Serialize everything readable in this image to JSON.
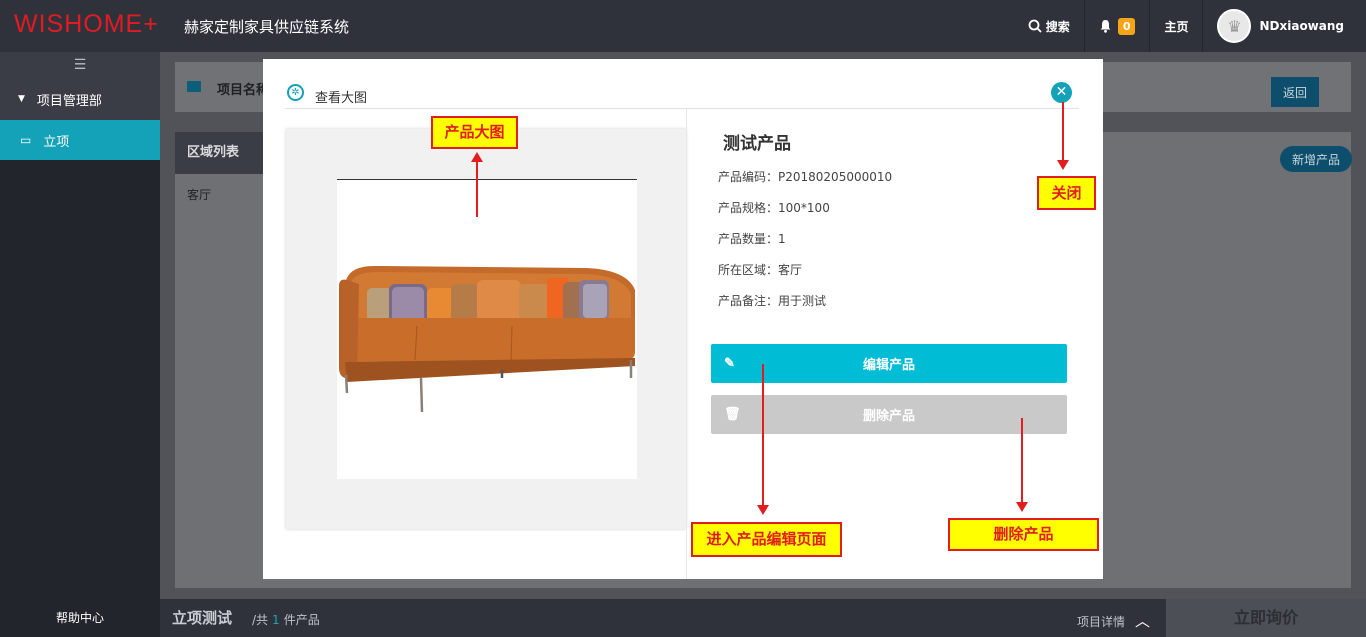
{
  "header": {
    "logo": "WISHOME+",
    "system_title": "赫家定制家具供应链系统",
    "search_label": "搜索",
    "notification_count": "0",
    "home_label": "主页",
    "username": "NDxiaowang"
  },
  "sidebar": {
    "department": "项目管理部",
    "items": [
      {
        "label": "立项"
      }
    ],
    "help_label": "帮助中心"
  },
  "main": {
    "project_label": "项目名称",
    "back_button": "返回",
    "area_list_title": "区域列表",
    "areas": [
      "客厅"
    ],
    "new_product_button": "新增产品"
  },
  "footer": {
    "project_name": "立项测试",
    "total_prefix": "/共",
    "total_count": "1",
    "total_suffix": "件产品",
    "detail_label": "项目详情",
    "inquiry_button": "立即询价"
  },
  "modal": {
    "title": "查看大图",
    "product_name": "测试产品",
    "fields": [
      {
        "label": "产品编码：",
        "value": "P20180205000010"
      },
      {
        "label": "产品规格：",
        "value": "100*100"
      },
      {
        "label": "产品数量：",
        "value": "1"
      },
      {
        "label": "所在区域：",
        "value": "客厅"
      },
      {
        "label": "产品备注：",
        "value": "用于测试"
      }
    ],
    "edit_button": "编辑产品",
    "delete_button": "删除产品"
  },
  "annotations": {
    "big_image": "产品大图",
    "close": "关闭",
    "edit_page": "进入产品编辑页面",
    "delete": "删除产品"
  },
  "colors": {
    "accent": "#14a2b8",
    "edit_button": "#00bcd4",
    "annotation_bg": "#ffff00",
    "annotation_border": "#e11d1d",
    "logo": "#e21b23"
  }
}
